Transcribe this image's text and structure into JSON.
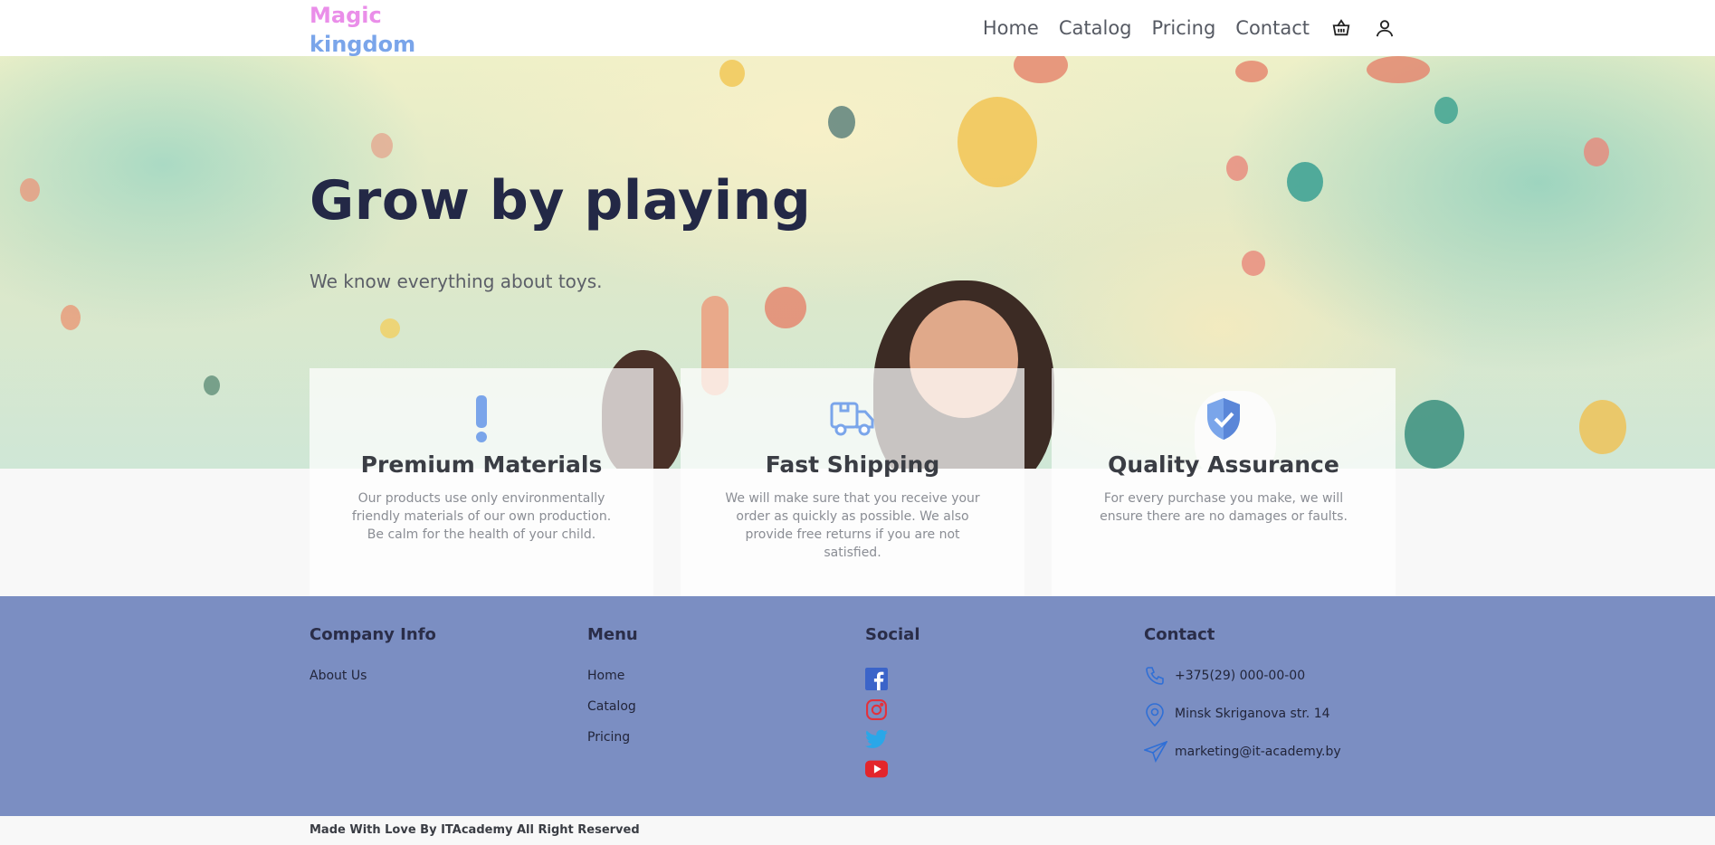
{
  "header": {
    "logo_line1": "Magic",
    "logo_line2": "kingdom",
    "nav": [
      "Home",
      "Catalog",
      "Pricing",
      "Contact"
    ],
    "icons": [
      "basket-icon",
      "user-icon"
    ]
  },
  "hero": {
    "title": "Grow by playing",
    "subtitle": "We know everything about toys."
  },
  "features": [
    {
      "icon": "exclamation-icon",
      "title": "Premium Materials",
      "text": "Our products use only environmentally friendly materials of our own production. Be calm for the health of your child."
    },
    {
      "icon": "truck-icon",
      "title": "Fast Shipping",
      "text": "We will make sure that you receive your order as quickly as possible. We also provide free returns if you are not satisfied."
    },
    {
      "icon": "shield-check-icon",
      "title": "Quality Assurance",
      "text": "For every purchase you make, we will ensure there are no damages or faults."
    }
  ],
  "footer": {
    "company": {
      "title": "Company Info",
      "links": [
        "About Us"
      ]
    },
    "menu": {
      "title": "Menu",
      "links": [
        "Home",
        "Catalog",
        "Pricing"
      ]
    },
    "social": {
      "title": "Social",
      "icons": [
        "facebook-icon",
        "instagram-icon",
        "twitter-icon",
        "youtube-icon"
      ]
    },
    "contact": {
      "title": "Contact",
      "phone": "+375(29) 000-00-00",
      "address": "Minsk Skriganova str. 14",
      "email": "marketing@it-academy.by"
    }
  },
  "copyright": "Made With Love By ITAcademy All Right Reserved",
  "colors": {
    "logo_pink": "#ea8ee9",
    "logo_blue": "#7aa5ea",
    "footer_bg": "#7b8ec2",
    "icon_blue": "#7aa5ea",
    "title_dark": "#232846"
  }
}
